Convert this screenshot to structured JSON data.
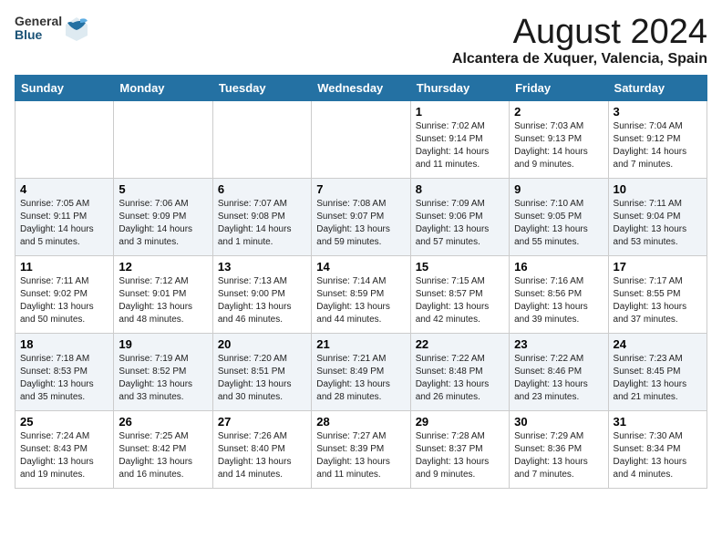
{
  "header": {
    "logo_general": "General",
    "logo_blue": "Blue",
    "month_title": "August 2024",
    "location": "Alcantera de Xuquer, Valencia, Spain"
  },
  "days_of_week": [
    "Sunday",
    "Monday",
    "Tuesday",
    "Wednesday",
    "Thursday",
    "Friday",
    "Saturday"
  ],
  "weeks": [
    [
      {
        "day": "",
        "info": ""
      },
      {
        "day": "",
        "info": ""
      },
      {
        "day": "",
        "info": ""
      },
      {
        "day": "",
        "info": ""
      },
      {
        "day": "1",
        "info": "Sunrise: 7:02 AM\nSunset: 9:14 PM\nDaylight: 14 hours\nand 11 minutes."
      },
      {
        "day": "2",
        "info": "Sunrise: 7:03 AM\nSunset: 9:13 PM\nDaylight: 14 hours\nand 9 minutes."
      },
      {
        "day": "3",
        "info": "Sunrise: 7:04 AM\nSunset: 9:12 PM\nDaylight: 14 hours\nand 7 minutes."
      }
    ],
    [
      {
        "day": "4",
        "info": "Sunrise: 7:05 AM\nSunset: 9:11 PM\nDaylight: 14 hours\nand 5 minutes."
      },
      {
        "day": "5",
        "info": "Sunrise: 7:06 AM\nSunset: 9:09 PM\nDaylight: 14 hours\nand 3 minutes."
      },
      {
        "day": "6",
        "info": "Sunrise: 7:07 AM\nSunset: 9:08 PM\nDaylight: 14 hours\nand 1 minute."
      },
      {
        "day": "7",
        "info": "Sunrise: 7:08 AM\nSunset: 9:07 PM\nDaylight: 13 hours\nand 59 minutes."
      },
      {
        "day": "8",
        "info": "Sunrise: 7:09 AM\nSunset: 9:06 PM\nDaylight: 13 hours\nand 57 minutes."
      },
      {
        "day": "9",
        "info": "Sunrise: 7:10 AM\nSunset: 9:05 PM\nDaylight: 13 hours\nand 55 minutes."
      },
      {
        "day": "10",
        "info": "Sunrise: 7:11 AM\nSunset: 9:04 PM\nDaylight: 13 hours\nand 53 minutes."
      }
    ],
    [
      {
        "day": "11",
        "info": "Sunrise: 7:11 AM\nSunset: 9:02 PM\nDaylight: 13 hours\nand 50 minutes."
      },
      {
        "day": "12",
        "info": "Sunrise: 7:12 AM\nSunset: 9:01 PM\nDaylight: 13 hours\nand 48 minutes."
      },
      {
        "day": "13",
        "info": "Sunrise: 7:13 AM\nSunset: 9:00 PM\nDaylight: 13 hours\nand 46 minutes."
      },
      {
        "day": "14",
        "info": "Sunrise: 7:14 AM\nSunset: 8:59 PM\nDaylight: 13 hours\nand 44 minutes."
      },
      {
        "day": "15",
        "info": "Sunrise: 7:15 AM\nSunset: 8:57 PM\nDaylight: 13 hours\nand 42 minutes."
      },
      {
        "day": "16",
        "info": "Sunrise: 7:16 AM\nSunset: 8:56 PM\nDaylight: 13 hours\nand 39 minutes."
      },
      {
        "day": "17",
        "info": "Sunrise: 7:17 AM\nSunset: 8:55 PM\nDaylight: 13 hours\nand 37 minutes."
      }
    ],
    [
      {
        "day": "18",
        "info": "Sunrise: 7:18 AM\nSunset: 8:53 PM\nDaylight: 13 hours\nand 35 minutes."
      },
      {
        "day": "19",
        "info": "Sunrise: 7:19 AM\nSunset: 8:52 PM\nDaylight: 13 hours\nand 33 minutes."
      },
      {
        "day": "20",
        "info": "Sunrise: 7:20 AM\nSunset: 8:51 PM\nDaylight: 13 hours\nand 30 minutes."
      },
      {
        "day": "21",
        "info": "Sunrise: 7:21 AM\nSunset: 8:49 PM\nDaylight: 13 hours\nand 28 minutes."
      },
      {
        "day": "22",
        "info": "Sunrise: 7:22 AM\nSunset: 8:48 PM\nDaylight: 13 hours\nand 26 minutes."
      },
      {
        "day": "23",
        "info": "Sunrise: 7:22 AM\nSunset: 8:46 PM\nDaylight: 13 hours\nand 23 minutes."
      },
      {
        "day": "24",
        "info": "Sunrise: 7:23 AM\nSunset: 8:45 PM\nDaylight: 13 hours\nand 21 minutes."
      }
    ],
    [
      {
        "day": "25",
        "info": "Sunrise: 7:24 AM\nSunset: 8:43 PM\nDaylight: 13 hours\nand 19 minutes."
      },
      {
        "day": "26",
        "info": "Sunrise: 7:25 AM\nSunset: 8:42 PM\nDaylight: 13 hours\nand 16 minutes."
      },
      {
        "day": "27",
        "info": "Sunrise: 7:26 AM\nSunset: 8:40 PM\nDaylight: 13 hours\nand 14 minutes."
      },
      {
        "day": "28",
        "info": "Sunrise: 7:27 AM\nSunset: 8:39 PM\nDaylight: 13 hours\nand 11 minutes."
      },
      {
        "day": "29",
        "info": "Sunrise: 7:28 AM\nSunset: 8:37 PM\nDaylight: 13 hours\nand 9 minutes."
      },
      {
        "day": "30",
        "info": "Sunrise: 7:29 AM\nSunset: 8:36 PM\nDaylight: 13 hours\nand 7 minutes."
      },
      {
        "day": "31",
        "info": "Sunrise: 7:30 AM\nSunset: 8:34 PM\nDaylight: 13 hours\nand 4 minutes."
      }
    ]
  ]
}
